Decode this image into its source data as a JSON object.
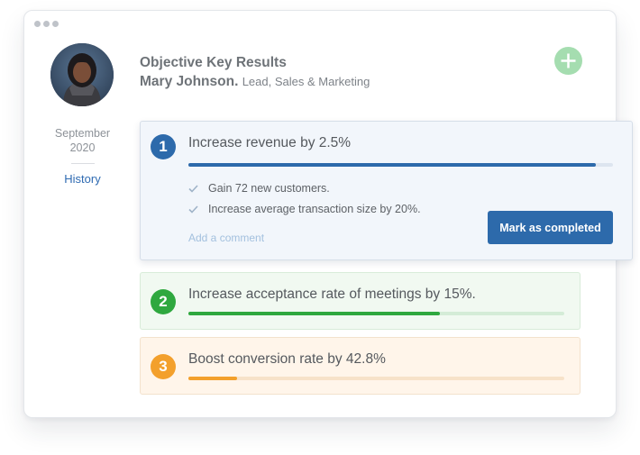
{
  "header": {
    "title": "Objective Key Results",
    "user_name": "Mary Johnson.",
    "user_role": "Lead, Sales & Marketing",
    "add_icon": "plus-icon"
  },
  "sidebar": {
    "period_month": "September",
    "period_year": "2020",
    "history_label": "History"
  },
  "objectives": [
    {
      "number": "1",
      "label": "Increase revenue by 2.5%",
      "progress": 0.96,
      "color": "#2d6aab",
      "key_results": [
        "Gain 72 new customers.",
        "Increase average transaction size by 20%."
      ],
      "comment_placeholder": "Add a comment",
      "action_label": "Mark as completed"
    },
    {
      "number": "2",
      "label": "Increase acceptance rate of meetings by 15%.",
      "progress": 0.67,
      "color": "#2fa83f"
    },
    {
      "number": "3",
      "label": "Boost conversion rate by 42.8%",
      "progress": 0.13,
      "color": "#f3a02c"
    }
  ],
  "colors": {
    "accent": "#2d6aab",
    "add_button": "#a5ddb0"
  }
}
